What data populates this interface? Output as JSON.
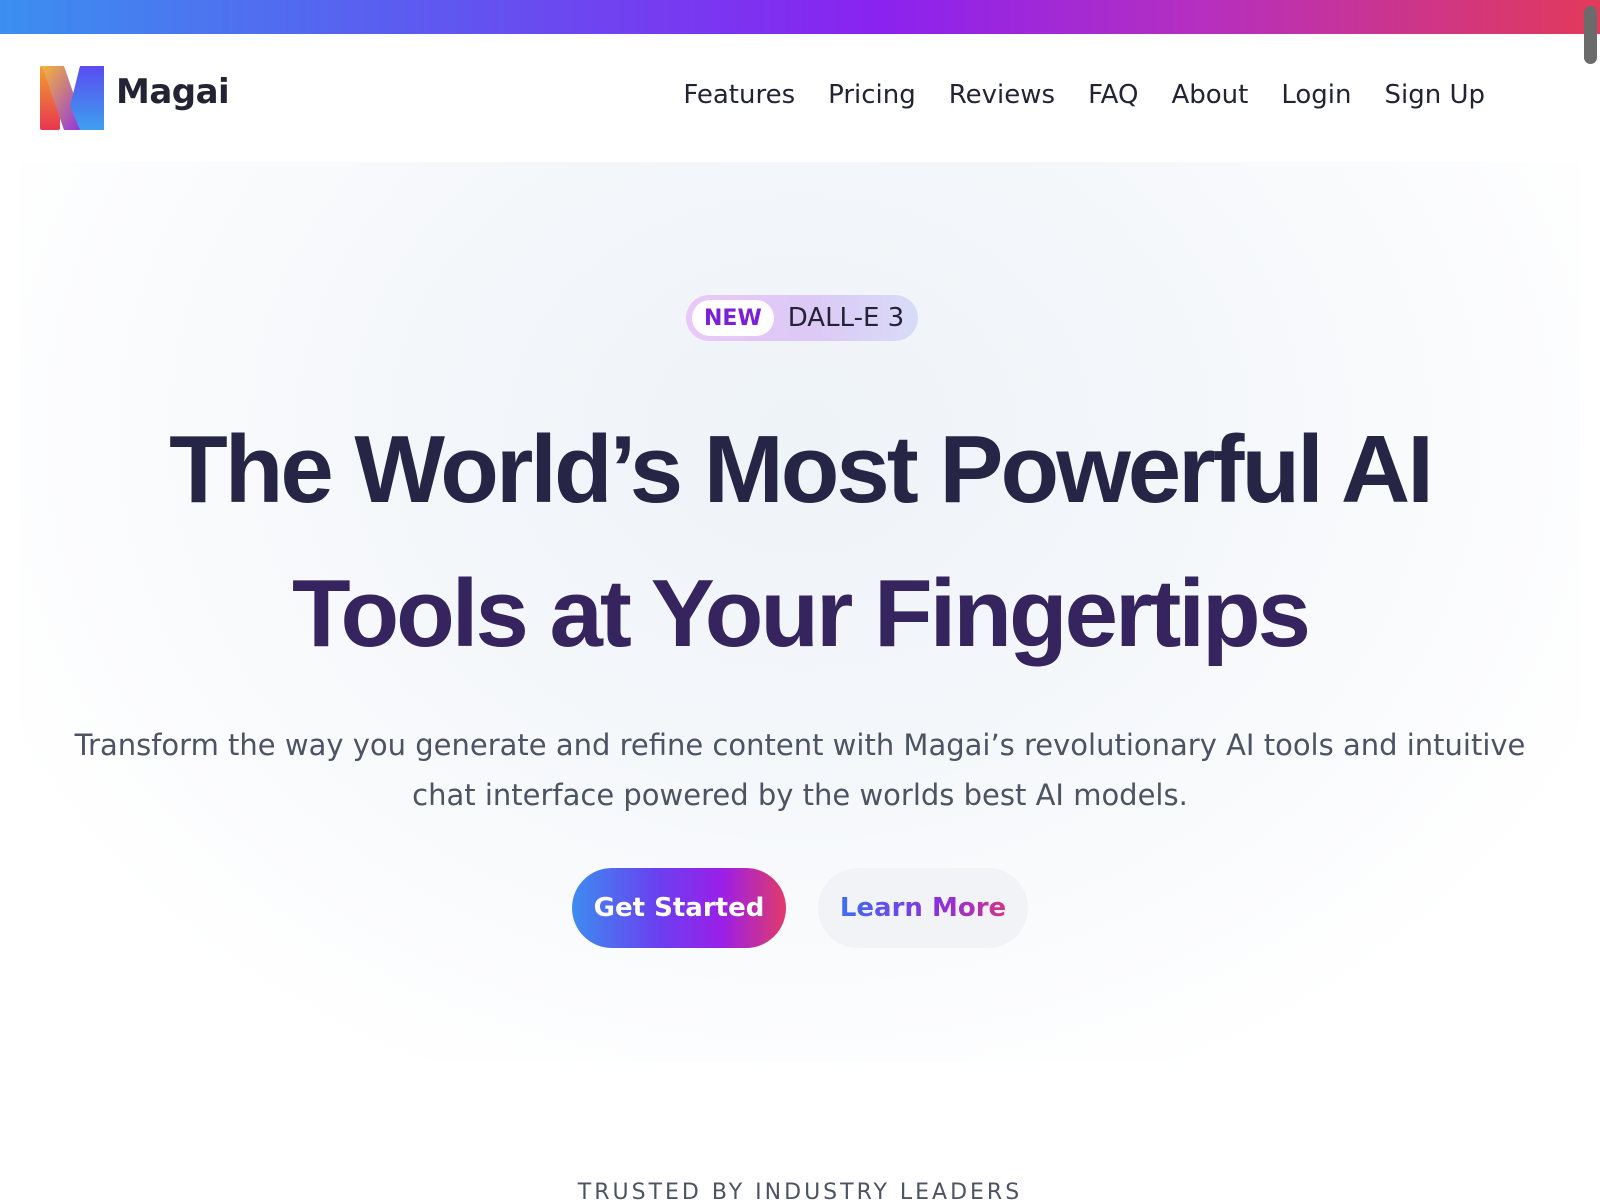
{
  "brand": {
    "name": "Magai",
    "logo_icon": "magai-m-logo-icon"
  },
  "nav": {
    "items": [
      {
        "label": "Features"
      },
      {
        "label": "Pricing"
      },
      {
        "label": "Reviews"
      },
      {
        "label": "FAQ"
      },
      {
        "label": "About"
      },
      {
        "label": "Login"
      },
      {
        "label": "Sign Up"
      }
    ]
  },
  "hero": {
    "badge": {
      "tag": "NEW",
      "text": "DALL-E 3"
    },
    "headline_line1": "The World’s Most Powerful AI",
    "headline_line2": "Tools at Your Fingertips",
    "subtext": "Transform the way you generate and refine content with Magai’s revolutionary AI tools and intuitive chat interface powered by the worlds best AI models.",
    "primary_cta": "Get Started",
    "secondary_cta": "Learn More"
  },
  "trusted": {
    "label": "TRUSTED BY INDUSTRY LEADERS"
  },
  "colors": {
    "heading": "#262545",
    "heading_accent": "#35245e",
    "body_text": "#4c5363",
    "badge_tag": "#7b1fd8",
    "gradient_blue": "#3d8cf0",
    "gradient_purple": "#9a1fe8",
    "gradient_pink": "#e23a6a"
  }
}
